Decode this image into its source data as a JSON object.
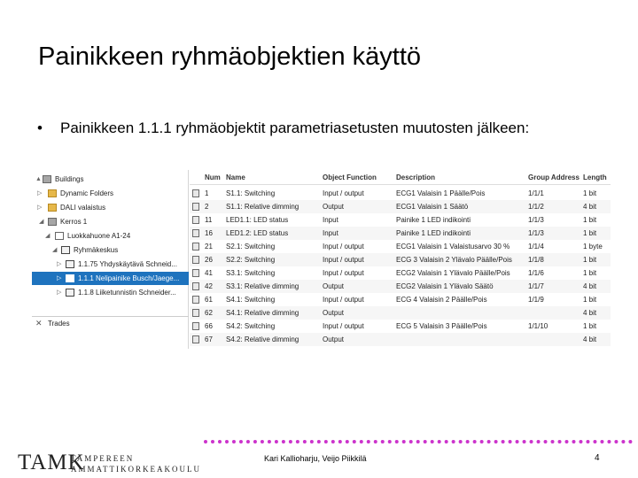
{
  "slide": {
    "title": "Painikkeen ryhmäobjektien käyttö",
    "bullet_dot": "•",
    "bullet_text": "Painikkeen 1.1.1 ryhmäobjektit parametriasetusten muutosten jälkeen:"
  },
  "tree": {
    "items": [
      {
        "label": "Buildings",
        "icon": "building-icon",
        "expander": "▲"
      },
      {
        "label": "Dynamic Folders",
        "icon": "folder-icon",
        "expander": "▷"
      },
      {
        "label": "DALI valaistus",
        "icon": "folder-icon",
        "expander": "▷"
      },
      {
        "label": "Kerros 1",
        "icon": "floor-icon",
        "expander": "◢"
      },
      {
        "label": "Luokkahuone A1-24",
        "icon": "room-icon",
        "expander": "◢"
      },
      {
        "label": "Ryhmäkeskus",
        "icon": "cabinet-icon",
        "expander": "◢"
      },
      {
        "label": "1.1.75 Yhdyskäytävä Schneid...",
        "icon": "device-icon",
        "expander": "▷"
      },
      {
        "label": "1.1.1 Nelipainike Busch/Jaege...",
        "icon": "device-icon",
        "expander": "▷"
      },
      {
        "label": "1.1.8 Liiketunnistin Schneider...",
        "icon": "device-icon",
        "expander": "▷"
      }
    ],
    "trades_label": "Trades"
  },
  "grid": {
    "columns": [
      "Num",
      "Name",
      "Object Function",
      "Description",
      "Group Address",
      "Length"
    ],
    "rows": [
      {
        "num": "1",
        "name": "S1.1: Switching",
        "function": "Input / output",
        "description": "ECG1 Valaisin 1 Päälle/Pois",
        "group": "1/1/1",
        "length": "1 bit"
      },
      {
        "num": "2",
        "name": "S1.1: Relative dimming",
        "function": "Output",
        "description": "ECG1 Valaisin 1 Säätö",
        "group": "1/1/2",
        "length": "4 bit"
      },
      {
        "num": "11",
        "name": "LED1.1: LED status",
        "function": "Input",
        "description": "Painike 1 LED indikointi",
        "group": "1/1/3",
        "length": "1 bit"
      },
      {
        "num": "16",
        "name": "LED1.2: LED status",
        "function": "Input",
        "description": "Painike 1 LED indikointi",
        "group": "1/1/3",
        "length": "1 bit"
      },
      {
        "num": "21",
        "name": "S2.1: Switching",
        "function": "Input / output",
        "description": "ECG1 Valaisin 1 Valaistusarvo 30 %",
        "group": "1/1/4",
        "length": "1 byte"
      },
      {
        "num": "26",
        "name": "S2.2: Switching",
        "function": "Input / output",
        "description": "ECG 3 Valaisin 2 Ylävalo Päälle/Pois",
        "group": "1/1/8",
        "length": "1 bit"
      },
      {
        "num": "41",
        "name": "S3.1: Switching",
        "function": "Input / output",
        "description": "ECG2 Valaisin 1 Ylävalo Päälle/Pois",
        "group": "1/1/6",
        "length": "1 bit"
      },
      {
        "num": "42",
        "name": "S3.1: Relative dimming",
        "function": "Output",
        "description": "ECG2 Valaisin 1 Ylävalo Säätö",
        "group": "1/1/7",
        "length": "4 bit"
      },
      {
        "num": "61",
        "name": "S4.1: Switching",
        "function": "Input / output",
        "description": "ECG 4 Valaisin 2 Päälle/Pois",
        "group": "1/1/9",
        "length": "1 bit"
      },
      {
        "num": "62",
        "name": "S4.1: Relative dimming",
        "function": "Output",
        "description": "",
        "group": "",
        "length": "4 bit"
      },
      {
        "num": "66",
        "name": "S4.2: Switching",
        "function": "Input / output",
        "description": "ECG 5 Valaisin 3 Päälle/Pois",
        "group": "1/1/10",
        "length": "1 bit"
      },
      {
        "num": "67",
        "name": "S4.2: Relative dimming",
        "function": "Output",
        "description": "",
        "group": "",
        "length": "4 bit"
      }
    ]
  },
  "footer": {
    "logo_mark": "TAMK",
    "logo_line1": "TAMPEREEN",
    "logo_line2": "AMMATTIKORKEAKOULU",
    "authors": "Kari Kallioharju, Veijo Piikkilä",
    "page_number": "4"
  },
  "colors": {
    "selection": "#1e73be",
    "footer_dots": "#cc33cc"
  }
}
